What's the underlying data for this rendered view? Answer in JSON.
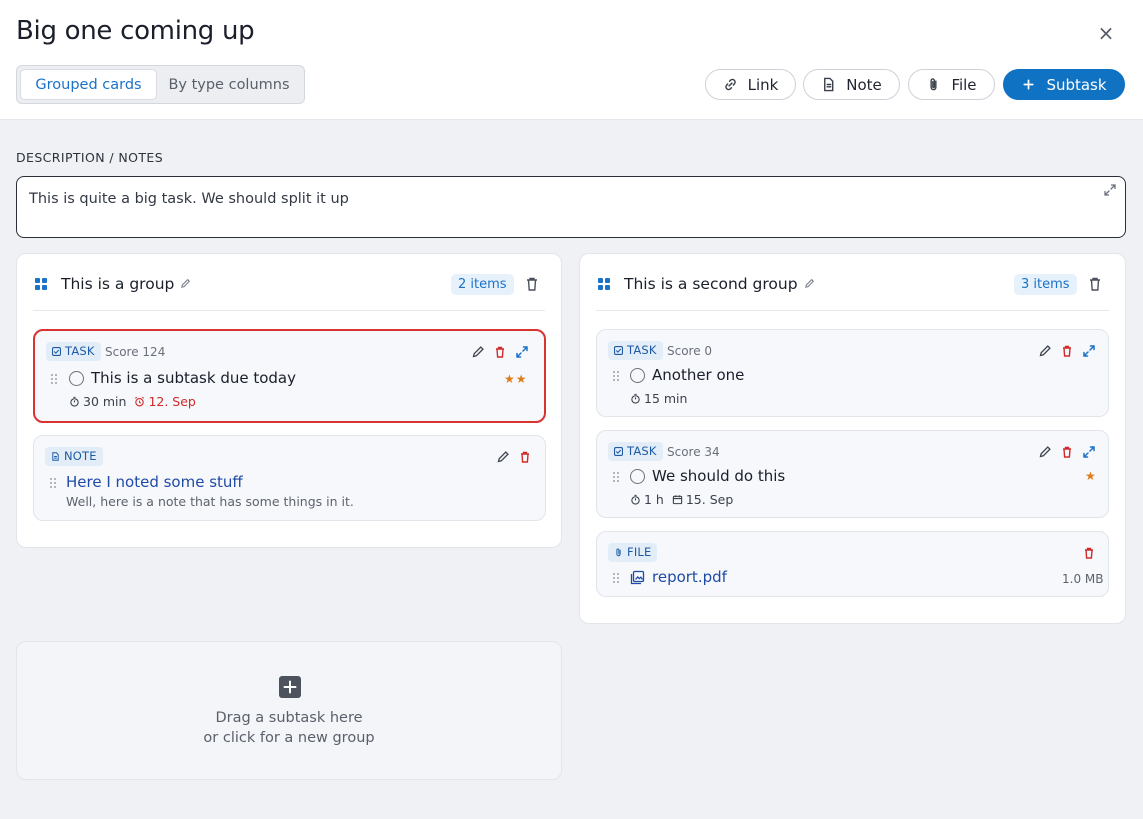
{
  "header": {
    "title": "Big one coming up",
    "close_label": "×",
    "view_tabs": [
      {
        "label": "Grouped cards",
        "active": true
      },
      {
        "label": "By type columns",
        "active": false
      }
    ],
    "buttons": {
      "link": "Link",
      "note": "Note",
      "file": "File",
      "subtask": "Subtask"
    }
  },
  "description": {
    "label": "DESCRIPTION / NOTES",
    "text": "This is quite a big task. We should split it up"
  },
  "groups": [
    {
      "title": "This is a group",
      "count": "2 items",
      "cards": [
        {
          "type": "TASK",
          "score": "Score 124",
          "title": "This is a subtask due today",
          "duration": "30 min",
          "due": "12. Sep",
          "stars": "★★",
          "selected": true
        },
        {
          "type": "NOTE",
          "title": "Here I noted some stuff",
          "body": "Well, here is a note that has some things in it."
        }
      ]
    },
    {
      "title": "This is a second group",
      "count": "3 items",
      "cards": [
        {
          "type": "TASK",
          "score": "Score 0",
          "title": "Another one",
          "duration": "15 min"
        },
        {
          "type": "TASK",
          "score": "Score 34",
          "title": "We should do this",
          "duration": "1 h",
          "date": "15. Sep",
          "stars": "★"
        },
        {
          "type": "FILE",
          "title": "report.pdf",
          "size": "1.0 MB"
        }
      ]
    }
  ],
  "dropzone": {
    "line1": "Drag a subtask here",
    "line2": "or click for a new group"
  },
  "colors": {
    "accent": "#0f72c3",
    "danger": "#d93232",
    "star": "#e07b1a",
    "tag_bg": "#e3edf8"
  }
}
